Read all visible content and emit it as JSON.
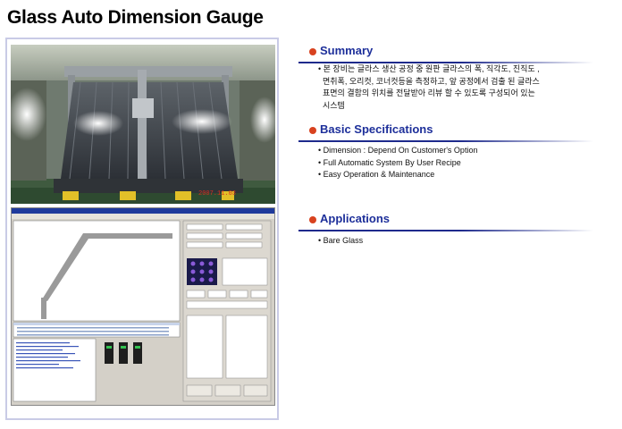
{
  "title": "Glass Auto Dimension Gauge",
  "photo": {
    "timestamp": "2007.11.03"
  },
  "sections": {
    "summary": {
      "heading": "Summary",
      "lines": [
        "• 본 장비는 글라스 생산 공정 중 원판 글라스의 폭, 직각도, 진직도 ,",
        "면취폭, 오리컷, 코너컷등을 측정하고, 앞 공정에서 검출 된 글라스",
        "표면의 결함의 위치를 전달받아 리뷰 할 수 있도록 구성되어 있는",
        "시스템"
      ]
    },
    "specs": {
      "heading": "Basic Specifications",
      "lines": [
        "• Dimension : Depend On Customer's Option",
        "• Full Automatic System By User Recipe",
        "• Easy Operation  & Maintenance"
      ]
    },
    "applications": {
      "heading": "Applications",
      "lines": [
        "• Bare Glass"
      ]
    }
  },
  "colors": {
    "heading_text": "#1d2f9a",
    "heading_rule": "#1e2a8c",
    "bullet": "#d8421f",
    "panel_border": "#c9cbe6"
  },
  "icons": [
    "bullet-dot-icon"
  ]
}
